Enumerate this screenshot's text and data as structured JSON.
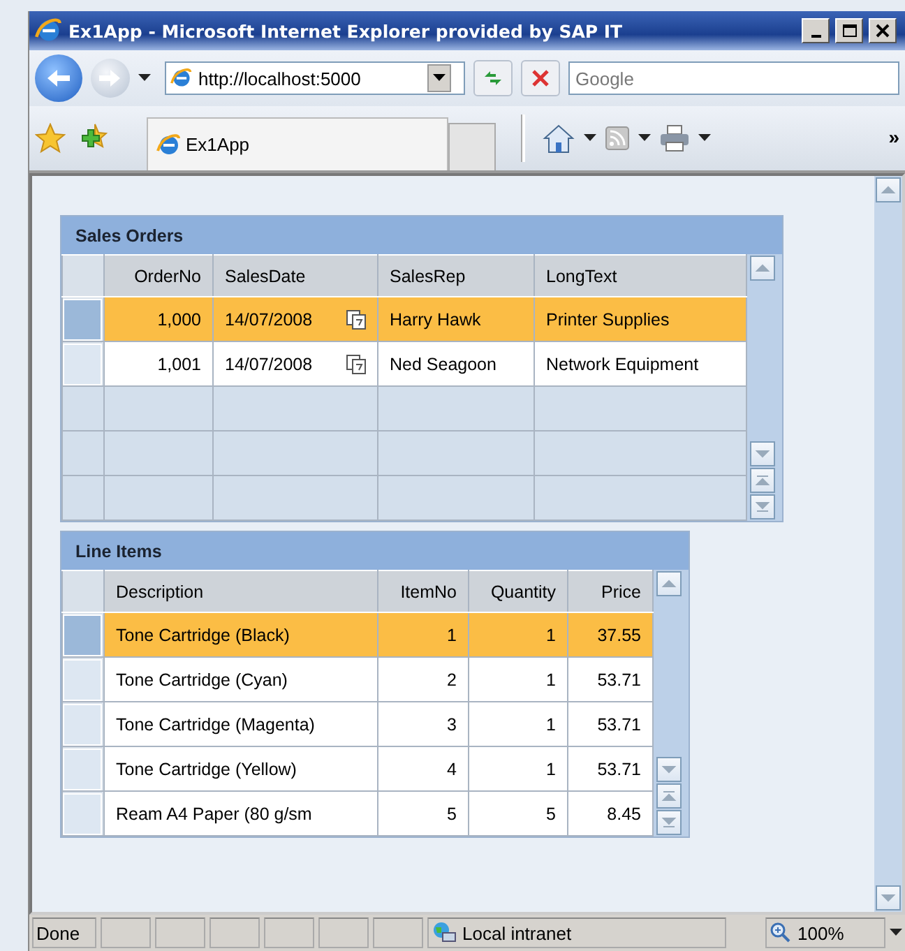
{
  "window": {
    "title": "Ex1App - Microsoft Internet Explorer provided by SAP IT"
  },
  "address_bar": {
    "value": "http://localhost:5000"
  },
  "search": {
    "placeholder": "Google"
  },
  "tab": {
    "label": "Ex1App"
  },
  "overflow": "»",
  "tables": [
    {
      "title": "Sales Orders",
      "columns": [
        {
          "label": "OrderNo"
        },
        {
          "label": "SalesDate",
          "kind": "date"
        },
        {
          "label": "SalesRep"
        },
        {
          "label": "LongText"
        }
      ],
      "rows": [
        {
          "selected": true,
          "cells": [
            "1,000",
            "14/07/2008",
            "Harry Hawk",
            "Printer Supplies"
          ]
        },
        {
          "selected": false,
          "cells": [
            "1,001",
            "14/07/2008",
            "Ned Seagoon",
            "Network Equipment"
          ]
        }
      ]
    },
    {
      "title": "Line Items",
      "columns": [
        {
          "label": "Description"
        },
        {
          "label": "ItemNo"
        },
        {
          "label": "Quantity"
        },
        {
          "label": "Price"
        }
      ],
      "rows": [
        {
          "selected": true,
          "cells": [
            "Tone Cartridge (Black)",
            "1",
            "1",
            "37.55"
          ]
        },
        {
          "selected": false,
          "cells": [
            "Tone Cartridge (Cyan)",
            "2",
            "1",
            "53.71"
          ]
        },
        {
          "selected": false,
          "cells": [
            "Tone Cartridge (Magenta)",
            "3",
            "1",
            "53.71"
          ]
        },
        {
          "selected": false,
          "cells": [
            "Tone Cartridge (Yellow)",
            "4",
            "1",
            "53.71"
          ]
        },
        {
          "selected": false,
          "cells": [
            "Ream A4 Paper (80 g/sm",
            "5",
            "5",
            "8.45"
          ]
        }
      ]
    }
  ],
  "status_bar": {
    "text": "Done",
    "zone": "Local intranet",
    "zoom": "100%"
  }
}
